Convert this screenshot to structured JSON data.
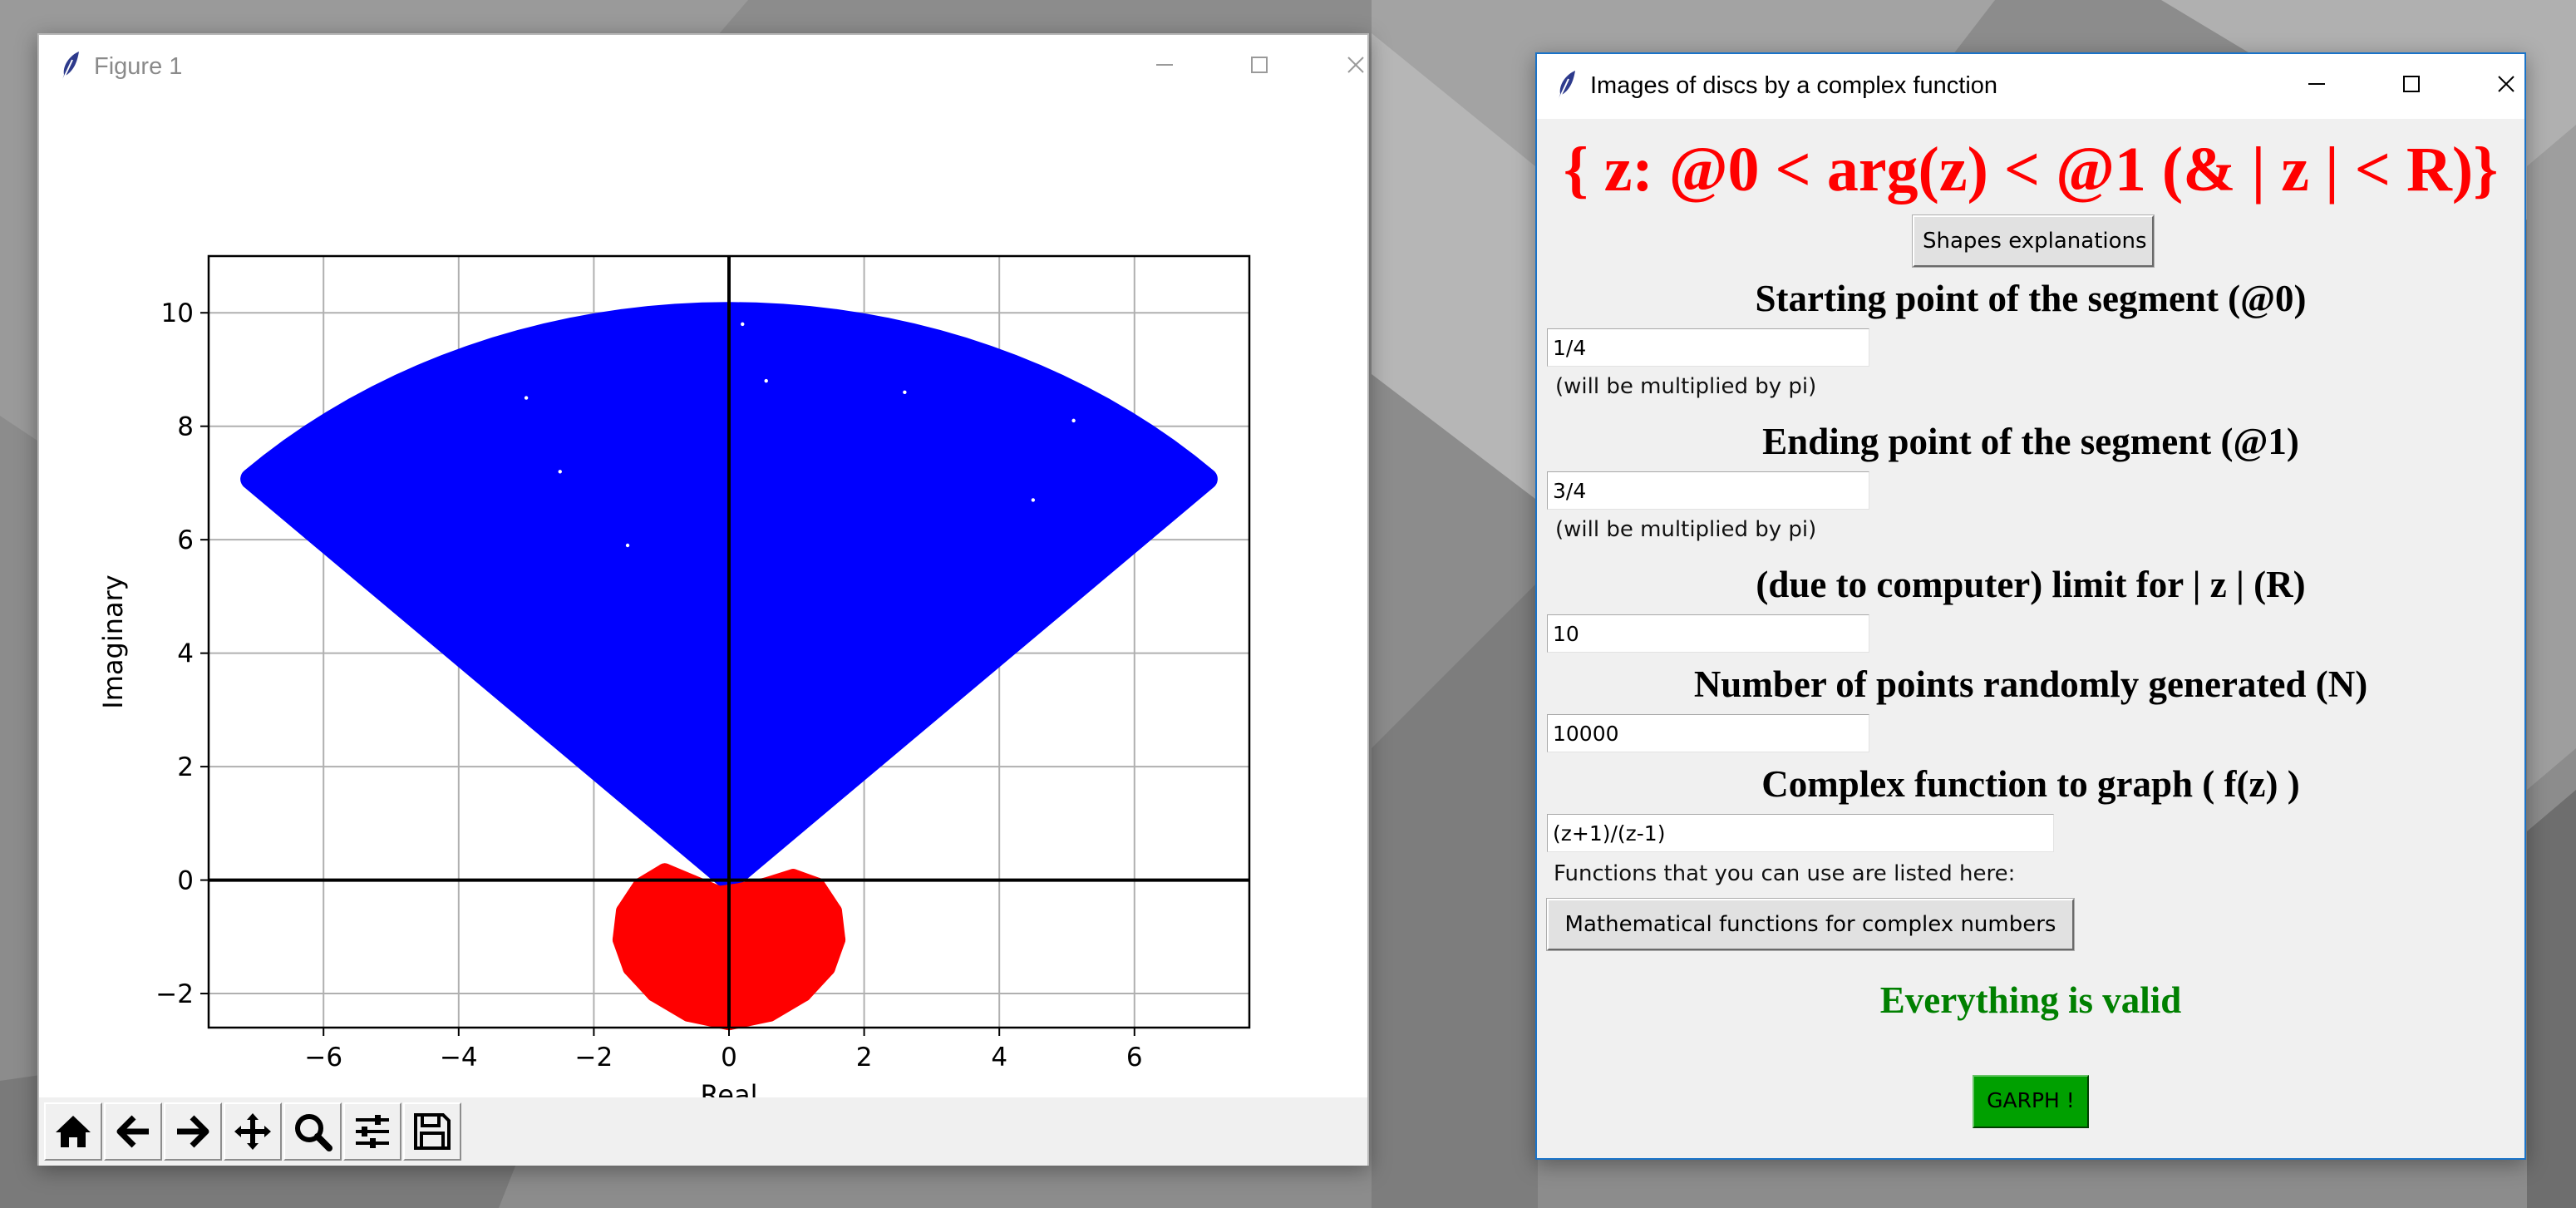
{
  "desktop": {
    "background": "#8f8f8f"
  },
  "figure_window": {
    "title": "Figure 1",
    "toolbar_icons": [
      "home-icon",
      "back-arrow-icon",
      "forward-arrow-icon",
      "pan-icon",
      "zoom-icon",
      "configure-subplots-icon",
      "save-icon"
    ]
  },
  "chart_data": {
    "type": "scatter",
    "title": "",
    "xlabel": "Real",
    "ylabel": "Imaginary",
    "xlim": [
      -7.7,
      7.7
    ],
    "ylim": [
      -2.6,
      11.0
    ],
    "xticks": [
      -6,
      -4,
      -2,
      0,
      2,
      4,
      6
    ],
    "yticks": [
      -2,
      0,
      2,
      4,
      6,
      8,
      10
    ],
    "xtick_labels": [
      "−6",
      "−4",
      "−2",
      "0",
      "2",
      "4",
      "6"
    ],
    "ytick_labels": [
      "−2",
      "0",
      "2",
      "4",
      "6",
      "8",
      "10"
    ],
    "grid": true,
    "axis_lines": {
      "x": 0,
      "y": 0
    },
    "series": [
      {
        "color": "#0000ff",
        "region": "sector",
        "vertex": [
          0,
          0
        ],
        "radius": 10,
        "angle_from_deg": 45,
        "angle_to_deg": 135
      },
      {
        "color": "#ff0000",
        "region": "image blob",
        "approx_center": [
          0,
          -0.95
        ],
        "approx_x_range": [
          -1.6,
          1.6
        ],
        "approx_y_range": [
          -2.5,
          0.15
        ]
      }
    ]
  },
  "control_window": {
    "title": "Images of discs by a complex function",
    "heading": "{ z: @0 < arg(z) < @1   (& | z | < R)}",
    "shapes_button": "Shapes explanations",
    "start_label": "Starting point of the segment (@0)",
    "start_value": "1/4",
    "start_note": "(will be multiplied by pi)",
    "end_label": "Ending point of the segment (@1)",
    "end_value": "3/4",
    "end_note": "(will be multiplied by pi)",
    "limit_label": "(due to computer) limit for | z | (R)",
    "limit_value": "10",
    "points_label": "Number of points randomly generated (N)",
    "points_value": "10000",
    "function_label": "Complex function to graph ( f(z) )",
    "function_value": "(z+1)/(z-1)",
    "functions_note": "Functions that you can use are listed here:",
    "math_button": "Mathematical functions for complex numbers",
    "status": "Everything is valid",
    "status_color": "#008000",
    "graph_button": "GARPH !",
    "graph_button_color": "#00a000"
  }
}
